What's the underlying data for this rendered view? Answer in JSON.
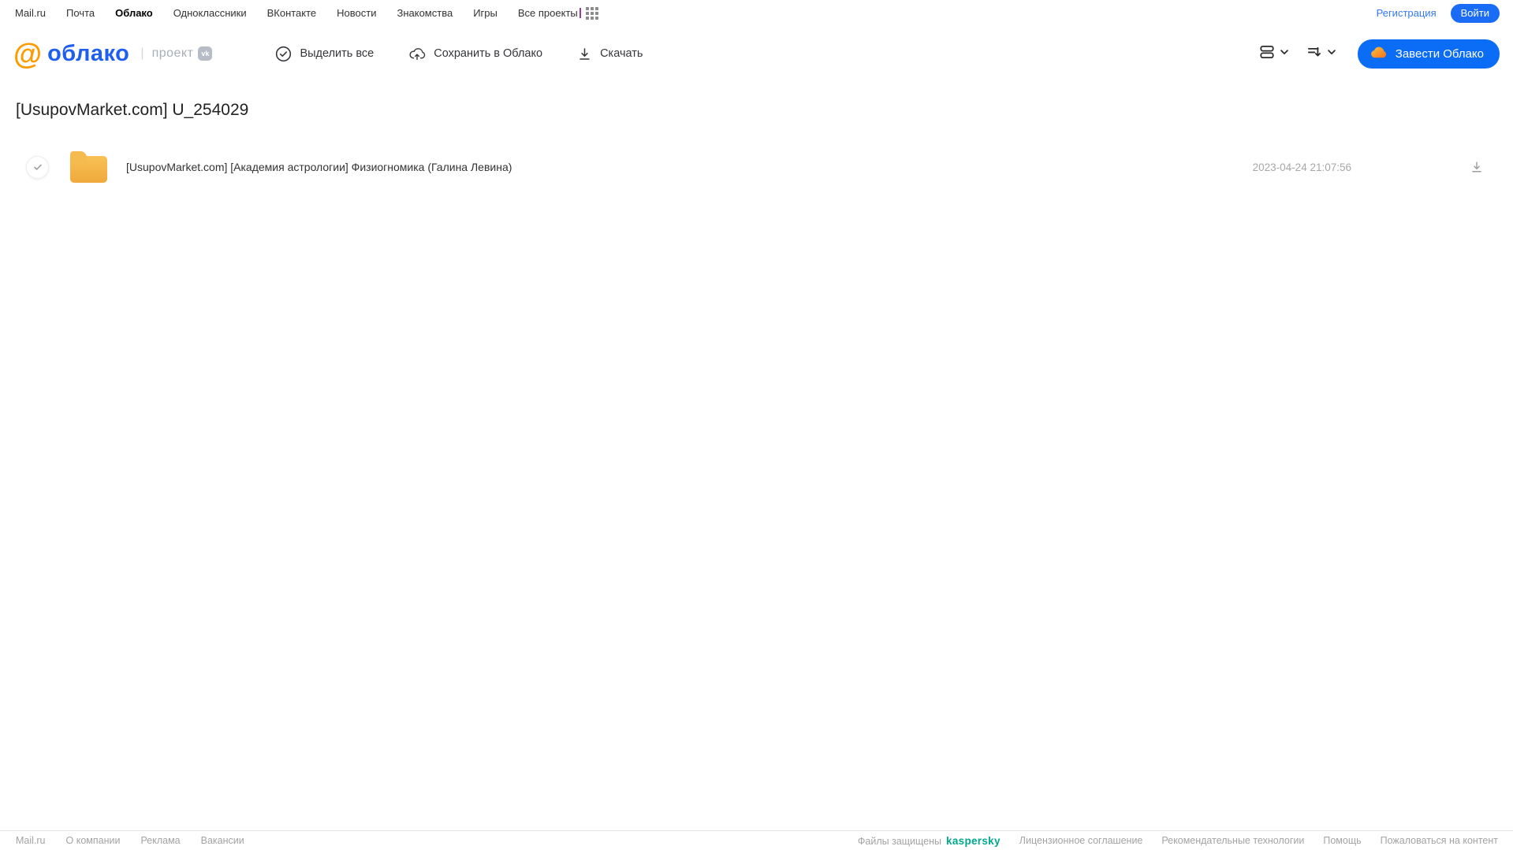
{
  "topnav": {
    "links": [
      "Mail.ru",
      "Почта",
      "Облако",
      "Одноклассники",
      "ВКонтакте",
      "Новости",
      "Знакомства",
      "Игры",
      "Все проекты"
    ],
    "active_link": "Облако",
    "registration_label": "Регистрация",
    "login_label": "Войти"
  },
  "header": {
    "logo_at": "@",
    "logo_text": "облако",
    "project_label": "проект",
    "vk_badge_label": "vk",
    "actions": {
      "select_all": "Выделить все",
      "save_to_cloud": "Сохранить в Облако",
      "download": "Скачать"
    },
    "get_cloud_button": "Завести Облако"
  },
  "main": {
    "title": "[UsupovMarket.com] U_254029",
    "files": [
      {
        "type": "folder",
        "name": "[UsupovMarket.com] [Академия астрологии] Физиогномика (Галина Левина)",
        "date": "2023-04-24 21:07:56"
      }
    ]
  },
  "footer": {
    "left_links": [
      "Mail.ru",
      "О компании",
      "Реклама",
      "Вакансии"
    ],
    "protected_label": "Файлы защищены",
    "kaspersky_label": "kaspersky",
    "right_links": [
      "Лицензионное соглашение",
      "Рекомендательные технологии",
      "Помощь",
      "Пожаловаться на контент"
    ]
  },
  "colors": {
    "brand_blue": "#1e5ff0",
    "button_blue": "#0b6cf5",
    "login_blue": "#1a6bf5",
    "logo_orange": "#ff9a00",
    "folder_yellow": "#f5b64a",
    "kaspersky_green": "#00a88e"
  }
}
